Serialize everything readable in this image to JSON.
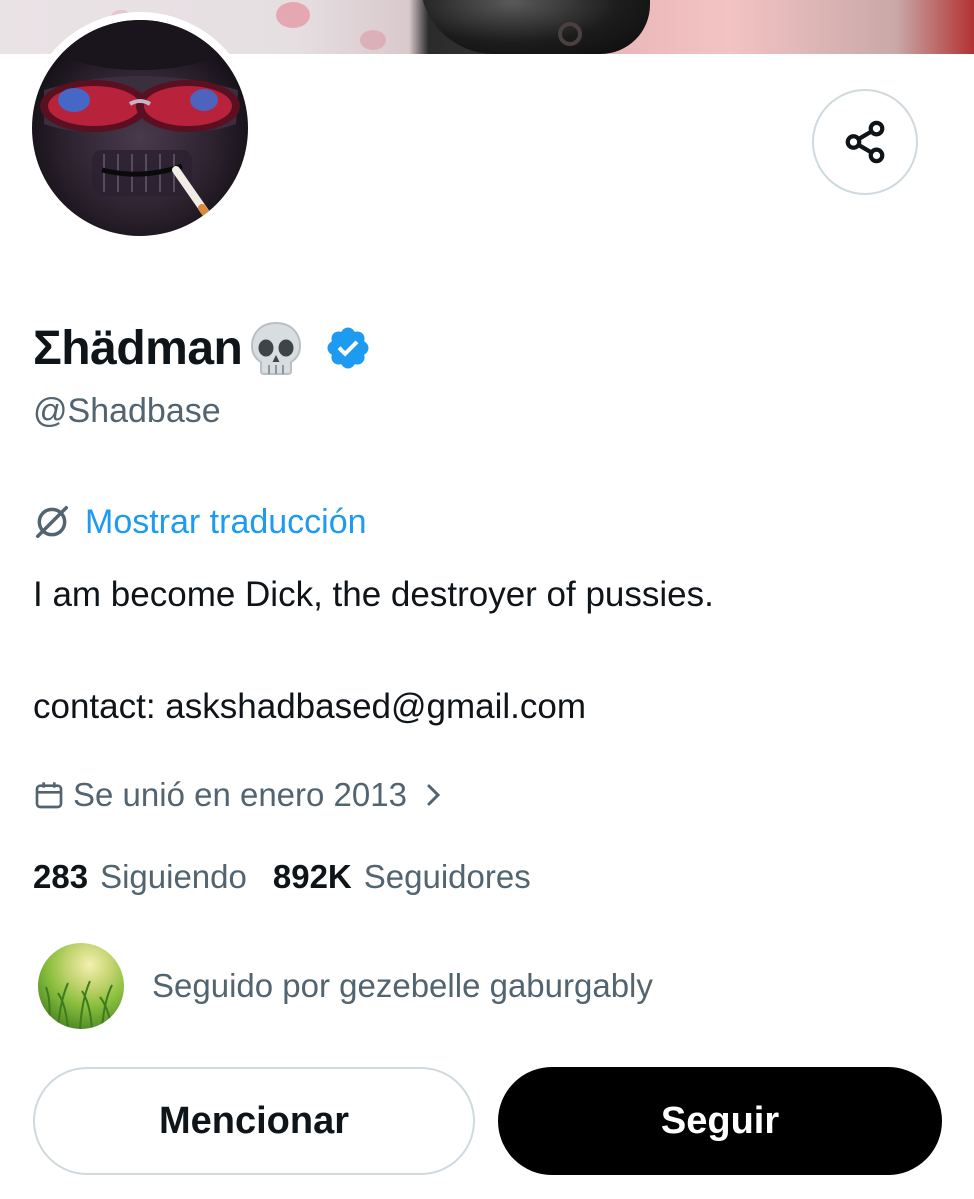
{
  "profile": {
    "display_name": "Σhädman",
    "name_emoji": "skull-icon",
    "verified": true,
    "handle": "@Shadbase",
    "translate_label": "Mostrar traducción",
    "bio": "I am become Dick, the destroyer of pussies.",
    "contact": "contact: askshadbased@gmail.com",
    "joined": "Se unió en enero 2013"
  },
  "stats": {
    "following_count": "283",
    "following_label": "Siguiendo",
    "followers_count": "892K",
    "followers_label": "Seguidores"
  },
  "followed_by": {
    "text": "Seguido por gezebelle gaburgably"
  },
  "actions": {
    "mention_label": "Mencionar",
    "follow_label": "Seguir"
  },
  "colors": {
    "link": "#1d9bf0",
    "verified": "#1d9bf0",
    "secondary_text": "#536471",
    "primary_text": "#0f1419",
    "border": "#cfd9de"
  },
  "icons": [
    "share-icon",
    "skull-icon",
    "verified-badge-icon",
    "translate-icon",
    "calendar-icon",
    "chevron-right-icon"
  ]
}
